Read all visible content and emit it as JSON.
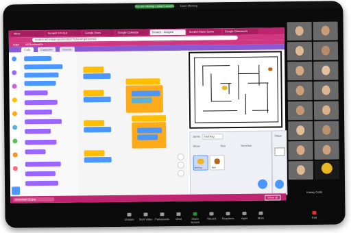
{
  "zoom": {
    "header_label": "You are viewing Lesley's screen",
    "window_title": "Zoom Meeting",
    "bottom_buttons": [
      {
        "label": "Unmute",
        "icon": "microphone-icon"
      },
      {
        "label": "Start Video",
        "icon": "video-icon"
      },
      {
        "label": "Participants",
        "icon": "participants-icon"
      },
      {
        "label": "Chat",
        "icon": "chat-icon"
      },
      {
        "label": "Share Screen",
        "icon": "share-screen-icon"
      },
      {
        "label": "Record",
        "icon": "record-icon"
      },
      {
        "label": "Reactions",
        "icon": "reactions-icon"
      },
      {
        "label": "Apps",
        "icon": "apps-icon"
      },
      {
        "label": "More",
        "icon": "more-icon"
      },
      {
        "label": "End",
        "icon": "end-icon"
      }
    ],
    "self_view_name": "Kinsey Cobb"
  },
  "browser": {
    "tabs": [
      "Inbox",
      "Scratch 3.0 GUI",
      "Google Docs",
      "Google Calendar",
      "Scratch - Imagine",
      "Scratch Maze Game",
      "Google Classroom"
    ],
    "active_tab": 4,
    "url": "scratch.mit.edu/projects/editor/?tutorial=getStarted",
    "bookmarks": [
      "Apps",
      "All Bookmarks"
    ],
    "download_file": "download (1).jpg",
    "show_all_label": "Show all"
  },
  "scratch": {
    "editor_tabs": [
      "Code",
      "Costumes",
      "Sounds"
    ],
    "categories": [
      {
        "name": "Motion",
        "color": "#4c97ff"
      },
      {
        "name": "Looks",
        "color": "#9966ff"
      },
      {
        "name": "Sound",
        "color": "#cf63cf"
      },
      {
        "name": "Events",
        "color": "#ffbf00"
      },
      {
        "name": "Control",
        "color": "#ffab19"
      },
      {
        "name": "Sensing",
        "color": "#5cb1d6"
      },
      {
        "name": "Operators",
        "color": "#59c059"
      },
      {
        "name": "Variables",
        "color": "#ff8c1a"
      },
      {
        "name": "My Blocks",
        "color": "#ff6680"
      },
      {
        "name": "Extensions",
        "color": "#0fbd8c"
      }
    ],
    "sprite_panel": {
      "sprite_label": "Sprite",
      "sprite_name": "ball frog",
      "show_label": "Show",
      "size_label": "Size",
      "direction_label": "Direction",
      "sprites": [
        "ball frog",
        "Bear"
      ],
      "stage_label": "Stage"
    }
  },
  "colors": {
    "zoom_bg": "#0b0b0b",
    "browser_accent": "#c0236f",
    "scratch_purple": "#8a5ad6",
    "motion_blue": "#4c97ff",
    "events_yellow": "#ffbf00"
  }
}
